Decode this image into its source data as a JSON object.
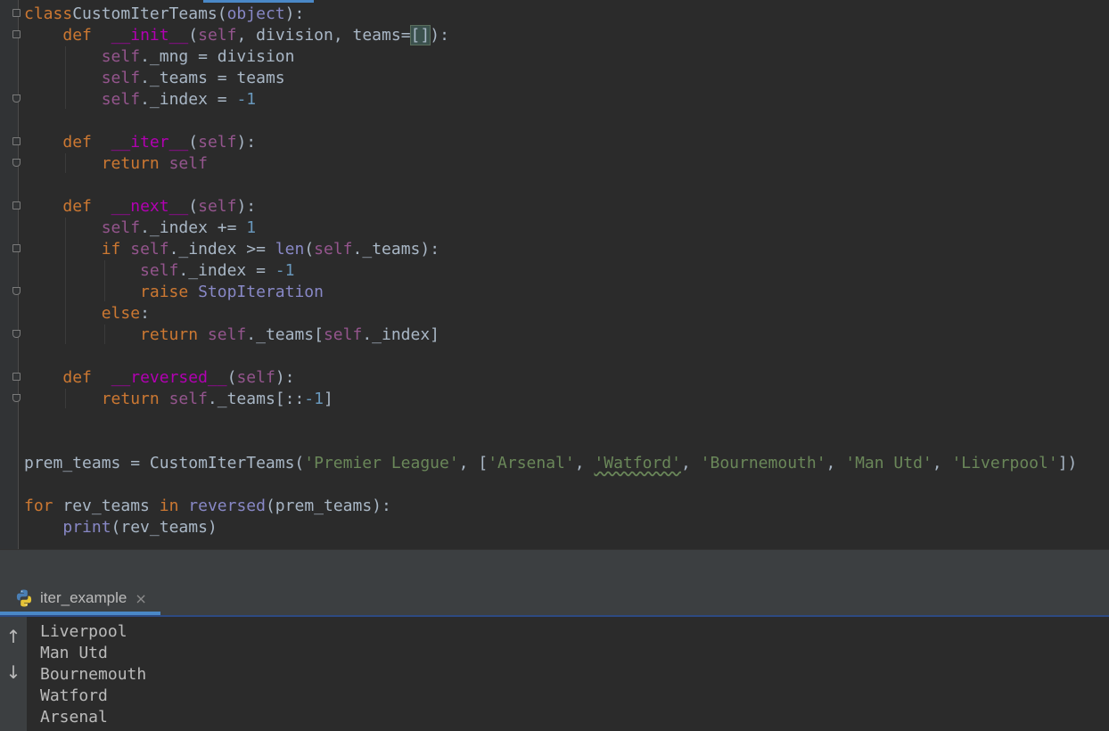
{
  "editor": {
    "lines": [
      [
        [
          "kw",
          "class"
        ],
        [
          "",
          "CustomIterTeams"
        ],
        [
          "",
          "("
        ],
        [
          "builtin",
          "object"
        ],
        [
          "",
          "):"
        ]
      ],
      [
        [
          "",
          "    "
        ],
        [
          "kw",
          "def"
        ],
        [
          "",
          "  "
        ],
        [
          "magic",
          "__init__"
        ],
        [
          "",
          "("
        ],
        [
          "self",
          "self"
        ],
        [
          "",
          ", division, teams="
        ],
        [
          "hl",
          "[]"
        ],
        [
          "",
          "):"
        ]
      ],
      [
        [
          "",
          "        "
        ],
        [
          "self",
          "self"
        ],
        [
          "",
          "._mng = division"
        ]
      ],
      [
        [
          "",
          "        "
        ],
        [
          "self",
          "self"
        ],
        [
          "",
          "._teams = teams"
        ]
      ],
      [
        [
          "",
          "        "
        ],
        [
          "self",
          "self"
        ],
        [
          "",
          "._index = "
        ],
        [
          "num",
          "-1"
        ]
      ],
      [
        [
          "",
          ""
        ]
      ],
      [
        [
          "",
          "    "
        ],
        [
          "kw",
          "def"
        ],
        [
          "",
          "  "
        ],
        [
          "magic",
          "__iter__"
        ],
        [
          "",
          "("
        ],
        [
          "self",
          "self"
        ],
        [
          "",
          "):"
        ]
      ],
      [
        [
          "",
          "        "
        ],
        [
          "kw",
          "return"
        ],
        [
          "self",
          " self"
        ]
      ],
      [
        [
          "",
          ""
        ]
      ],
      [
        [
          "",
          "    "
        ],
        [
          "kw",
          "def"
        ],
        [
          "",
          "  "
        ],
        [
          "magic",
          "__next__"
        ],
        [
          "",
          "("
        ],
        [
          "self",
          "self"
        ],
        [
          "",
          "):"
        ]
      ],
      [
        [
          "",
          "        "
        ],
        [
          "self",
          "self"
        ],
        [
          "",
          "._index += "
        ],
        [
          "num",
          "1"
        ]
      ],
      [
        [
          "",
          "        "
        ],
        [
          "kw",
          "if"
        ],
        [
          "self",
          " self"
        ],
        [
          "",
          "._index >= "
        ],
        [
          "builtin",
          "len"
        ],
        [
          "",
          "("
        ],
        [
          "self",
          "self"
        ],
        [
          "",
          "._teams):"
        ]
      ],
      [
        [
          "",
          "            "
        ],
        [
          "self",
          "self"
        ],
        [
          "",
          "._index = "
        ],
        [
          "num",
          "-1"
        ]
      ],
      [
        [
          "",
          "            "
        ],
        [
          "kw",
          "raise"
        ],
        [
          "",
          " "
        ],
        [
          "builtin",
          "StopIteration"
        ]
      ],
      [
        [
          "",
          "        "
        ],
        [
          "kw",
          "else"
        ],
        [
          "",
          ":"
        ]
      ],
      [
        [
          "",
          "            "
        ],
        [
          "kw",
          "return"
        ],
        [
          "self",
          " self"
        ],
        [
          "",
          "._teams["
        ],
        [
          "self",
          "self"
        ],
        [
          "",
          "._index]"
        ]
      ],
      [
        [
          "",
          ""
        ]
      ],
      [
        [
          "",
          "    "
        ],
        [
          "kw",
          "def"
        ],
        [
          "",
          "  "
        ],
        [
          "magic",
          "__reversed__"
        ],
        [
          "",
          "("
        ],
        [
          "self",
          "self"
        ],
        [
          "",
          "):"
        ]
      ],
      [
        [
          "",
          "        "
        ],
        [
          "kw",
          "return"
        ],
        [
          "self",
          " self"
        ],
        [
          "",
          "._teams[::"
        ],
        [
          "num",
          "-1"
        ],
        [
          "",
          "]"
        ]
      ],
      [
        [
          "",
          ""
        ]
      ],
      [
        [
          "",
          ""
        ]
      ],
      [
        [
          "",
          "prem_teams = CustomIterTeams("
        ],
        [
          "str",
          "'Premier League'"
        ],
        [
          "",
          ", ["
        ],
        [
          "str",
          "'Arsenal'"
        ],
        [
          "",
          ", "
        ],
        [
          "strsq",
          "'Watford'"
        ],
        [
          "",
          ", "
        ],
        [
          "str",
          "'Bournemouth'"
        ],
        [
          "",
          ", "
        ],
        [
          "str",
          "'Man Utd'"
        ],
        [
          "",
          ", "
        ],
        [
          "str",
          "'Liverpool'"
        ],
        [
          "",
          "])"
        ]
      ],
      [
        [
          "",
          ""
        ]
      ],
      [
        [
          "kw",
          "for"
        ],
        [
          "",
          " rev_teams "
        ],
        [
          "kw",
          "in"
        ],
        [
          "",
          " "
        ],
        [
          "builtin",
          "reversed"
        ],
        [
          "",
          "(prem_teams):"
        ]
      ],
      [
        [
          "",
          "    "
        ],
        [
          "builtin",
          "print"
        ],
        [
          "",
          "(rev_teams)"
        ]
      ]
    ]
  },
  "run_panel": {
    "tab_label": "iter_example",
    "close_glyph": "×",
    "toolbar": {
      "up_arrow": "↑",
      "down_arrow": "↓"
    },
    "output": [
      "Liverpool",
      "Man Utd",
      "Bournemouth",
      "Watford",
      "Arsenal"
    ]
  },
  "colors": {
    "keyword": "#cc7832",
    "self": "#94558d",
    "number": "#6897bb",
    "string": "#6a8759",
    "magic": "#b200b2",
    "builtin": "#8888c6",
    "default_text": "#a9b7c6",
    "background": "#2b2b2b",
    "accent": "#4a88c7"
  }
}
